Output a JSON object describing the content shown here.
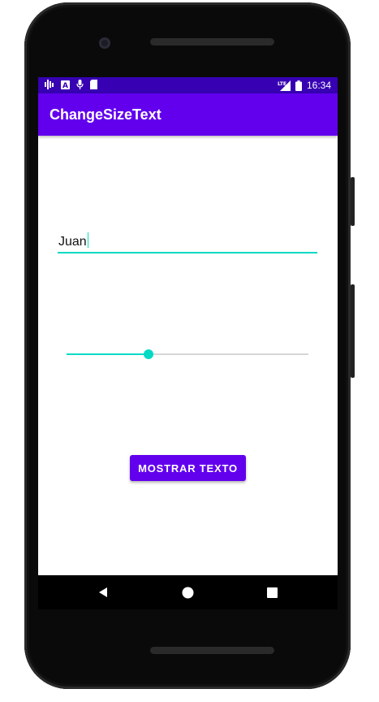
{
  "status_bar": {
    "icons": [
      "signal-bars-icon",
      "a-notification-icon",
      "mic-icon",
      "sd-card-icon",
      "lte-signal-icon",
      "battery-icon"
    ],
    "lte_label": "LTE",
    "time": "16:34"
  },
  "app_bar": {
    "title": "ChangeSizeText"
  },
  "text_input": {
    "value": "Juan"
  },
  "slider": {
    "value_fraction": 0.34
  },
  "button": {
    "label": "MOSTRAR TEXTO"
  },
  "nav_bar": {
    "icons": [
      "back-icon",
      "home-icon",
      "recents-icon"
    ]
  },
  "colors": {
    "primary": "#6200ee",
    "primary_dark": "#3700b3",
    "accent": "#03dac5"
  }
}
